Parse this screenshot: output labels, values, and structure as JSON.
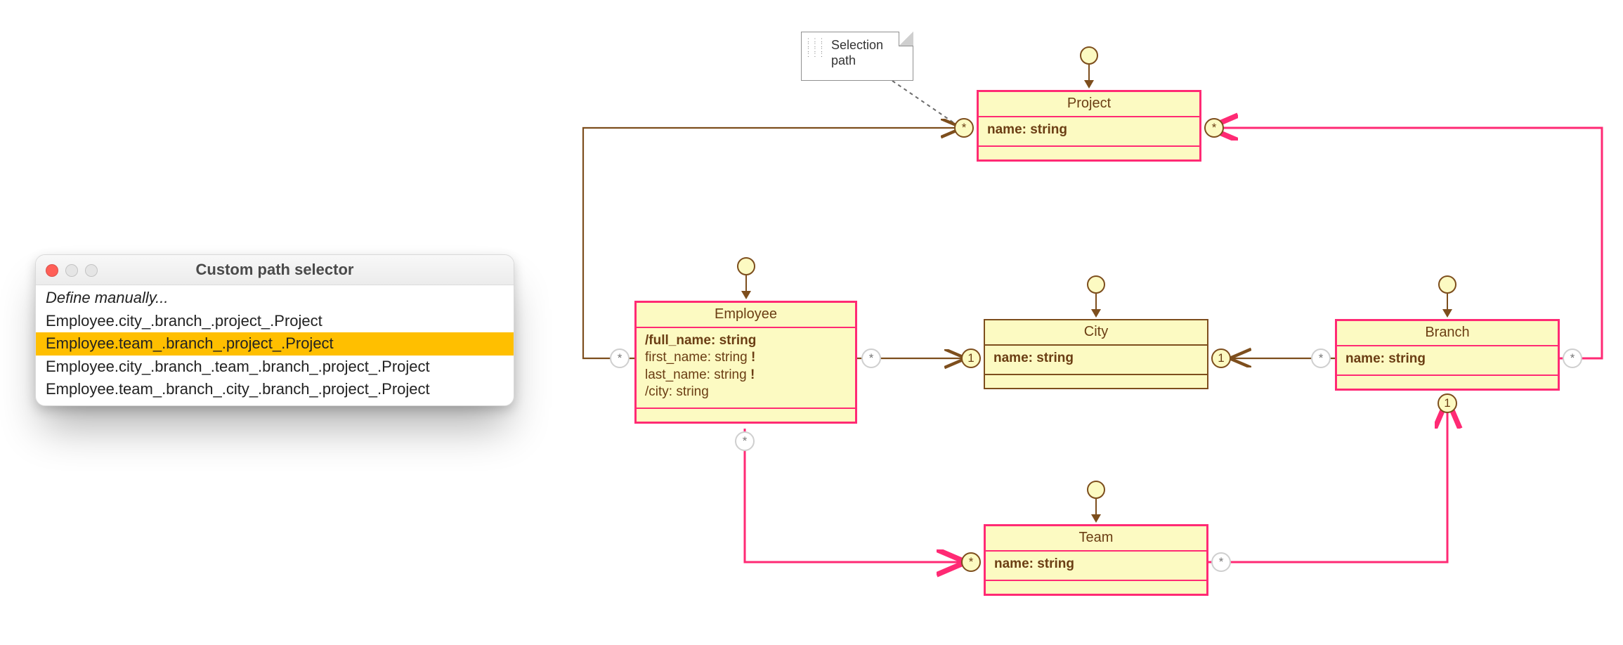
{
  "popup": {
    "title": "Custom path selector",
    "items": [
      {
        "label": "Define manually...",
        "italic": true,
        "selected": false
      },
      {
        "label": "Employee.city_.branch_.project_.Project",
        "italic": false,
        "selected": false
      },
      {
        "label": "Employee.team_.branch_.project_.Project",
        "italic": false,
        "selected": true
      },
      {
        "label": "Employee.city_.branch_.team_.branch_.project_.Project",
        "italic": false,
        "selected": false
      },
      {
        "label": "Employee.team_.branch_.city_.branch_.project_.Project",
        "italic": false,
        "selected": false
      }
    ]
  },
  "note": {
    "line1": "Selection",
    "line2": "path"
  },
  "classes": {
    "project": {
      "name": "Project",
      "attrs": [
        {
          "text": "name: string",
          "bold": true
        }
      ],
      "highlight": true
    },
    "employee": {
      "name": "Employee",
      "attrs": [
        {
          "text": "/full_name: string",
          "bold": true
        },
        {
          "text": "first_name: string",
          "bang": true
        },
        {
          "text": "last_name: string",
          "bang": true
        },
        {
          "text": "/city: string"
        }
      ],
      "highlight": true
    },
    "city": {
      "name": "City",
      "attrs": [
        {
          "text": "name: string",
          "bold": true
        }
      ],
      "highlight": false
    },
    "branch": {
      "name": "Branch",
      "attrs": [
        {
          "text": "name: string",
          "bold": true
        }
      ],
      "highlight": true
    },
    "team": {
      "name": "Team",
      "attrs": [
        {
          "text": "name: string",
          "bold": true
        }
      ],
      "highlight": true
    }
  },
  "multiplicities": {
    "proj_left_star": "*",
    "proj_right_star": "*",
    "emp_left_star": "*",
    "emp_right_star": "*",
    "emp_bottom_star": "*",
    "city_left_one": "1",
    "city_right_one": "1",
    "branch_right_star": "*",
    "branch_bottom_one": "1",
    "team_left_star": "*",
    "team_right_star": "*",
    "branch_left_star": "*"
  }
}
